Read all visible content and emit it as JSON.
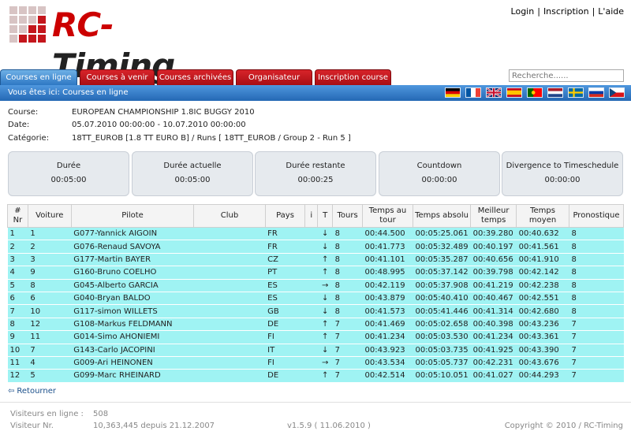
{
  "header": {
    "brand_rc": "RC",
    "brand_sep": "-",
    "brand_timing": "Timing",
    "links": {
      "login": "Login",
      "signup": "Inscription",
      "help": "L'aide"
    }
  },
  "tabs": [
    {
      "label": "Courses en ligne",
      "active": true
    },
    {
      "label": "Courses à venir",
      "active": false
    },
    {
      "label": "Courses archivées",
      "active": false
    },
    {
      "label": "Organisateur",
      "active": false
    },
    {
      "label": "Inscription course",
      "active": false
    }
  ],
  "search": {
    "placeholder": "Recherche......"
  },
  "breadcrumb": "Vous êtes ici: Courses en ligne",
  "flags": [
    "germany-flag",
    "france-flag",
    "uk-flag",
    "spain-flag",
    "portugal-flag",
    "netherlands-flag",
    "sweden-flag",
    "russia-flag",
    "czech-flag"
  ],
  "info": {
    "course_label": "Course:",
    "course_value": "EUROPEAN CHAMPIONSHIP 1.8IC BUGGY 2010",
    "date_label": "Date:",
    "date_value": "05.07.2010 00:00:00 - 10.07.2010 00:00:00",
    "category_label": "Catégorie:",
    "category_value": "18TT_EUROB [1.8 TT EURO B] / Runs [ 18TT_EUROB / Group 2 - Run 5 ]"
  },
  "timers": [
    {
      "title": "Durée",
      "value": "00:05:00"
    },
    {
      "title": "Durée actuelle",
      "value": "00:05:00"
    },
    {
      "title": "Durée restante",
      "value": "00:00:25"
    },
    {
      "title": "Countdown",
      "value": "00:00:00"
    },
    {
      "title": "Divergence to Timeschedule",
      "value": "00:00:00"
    }
  ],
  "table": {
    "headers": [
      "# Nr",
      "Voiture",
      "Pilote",
      "Club",
      "Pays",
      "i",
      "T",
      "Tours",
      "Temps au tour",
      "Temps absolu",
      "Meilleur temps",
      "Temps moyen",
      "Pronostique"
    ],
    "rows": [
      [
        "1",
        "1",
        "G077-Yannick AIGOIN",
        "",
        "FR",
        "",
        "down",
        "8",
        "00:44.500",
        "00:05:25.061",
        "00:39.280",
        "00:40.632",
        "8"
      ],
      [
        "2",
        "2",
        "G076-Renaud SAVOYA",
        "",
        "FR",
        "",
        "down",
        "8",
        "00:41.773",
        "00:05:32.489",
        "00:40.197",
        "00:41.561",
        "8"
      ],
      [
        "3",
        "3",
        "G177-Martin BAYER",
        "",
        "CZ",
        "",
        "up",
        "8",
        "00:41.101",
        "00:05:35.287",
        "00:40.656",
        "00:41.910",
        "8"
      ],
      [
        "4",
        "9",
        "G160-Bruno COELHO",
        "",
        "PT",
        "",
        "up",
        "8",
        "00:48.995",
        "00:05:37.142",
        "00:39.798",
        "00:42.142",
        "8"
      ],
      [
        "5",
        "8",
        "G045-Alberto GARCIA",
        "",
        "ES",
        "",
        "right",
        "8",
        "00:42.119",
        "00:05:37.908",
        "00:41.219",
        "00:42.238",
        "8"
      ],
      [
        "6",
        "6",
        "G040-Bryan BALDO",
        "",
        "ES",
        "",
        "down",
        "8",
        "00:43.879",
        "00:05:40.410",
        "00:40.467",
        "00:42.551",
        "8"
      ],
      [
        "7",
        "10",
        "G117-simon WILLETS",
        "",
        "GB",
        "",
        "down",
        "8",
        "00:41.573",
        "00:05:41.446",
        "00:41.314",
        "00:42.680",
        "8"
      ],
      [
        "8",
        "12",
        "G108-Markus FELDMANN",
        "",
        "DE",
        "",
        "up",
        "7",
        "00:41.469",
        "00:05:02.658",
        "00:40.398",
        "00:43.236",
        "7"
      ],
      [
        "9",
        "11",
        "G014-Simo AHONIEMI",
        "",
        "FI",
        "",
        "up",
        "7",
        "00:41.234",
        "00:05:03.530",
        "00:41.234",
        "00:43.361",
        "7"
      ],
      [
        "10",
        "7",
        "G143-Carlo JACOPINI",
        "",
        "IT",
        "",
        "down",
        "7",
        "00:43.923",
        "00:05:03.735",
        "00:41.925",
        "00:43.390",
        "7"
      ],
      [
        "11",
        "4",
        "G009-Ari HEINONEN",
        "",
        "FI",
        "",
        "right",
        "7",
        "00:43.534",
        "00:05:05.737",
        "00:42.231",
        "00:43.676",
        "7"
      ],
      [
        "12",
        "5",
        "G099-Marc RHEINARD",
        "",
        "DE",
        "",
        "up",
        "7",
        "00:42.514",
        "00:05:10.051",
        "00:41.027",
        "00:44.293",
        "7"
      ]
    ]
  },
  "back_label": "Retourner",
  "footer": {
    "visitors_online_label": "Visiteurs en ligne :",
    "visitors_online": "508",
    "visitor_nr_label": "Visiteur Nr.",
    "visitor_nr": "10,363,445 depuis 21.12.2007",
    "version": "v1.5.9 ( 11.06.2010 )",
    "copyright": "Copyright © 2010 / RC-Timing"
  },
  "colors": {
    "row_bg": "#9ff3f3",
    "tab_red": "#c0171d",
    "bar_blue": "#2f7bca"
  }
}
